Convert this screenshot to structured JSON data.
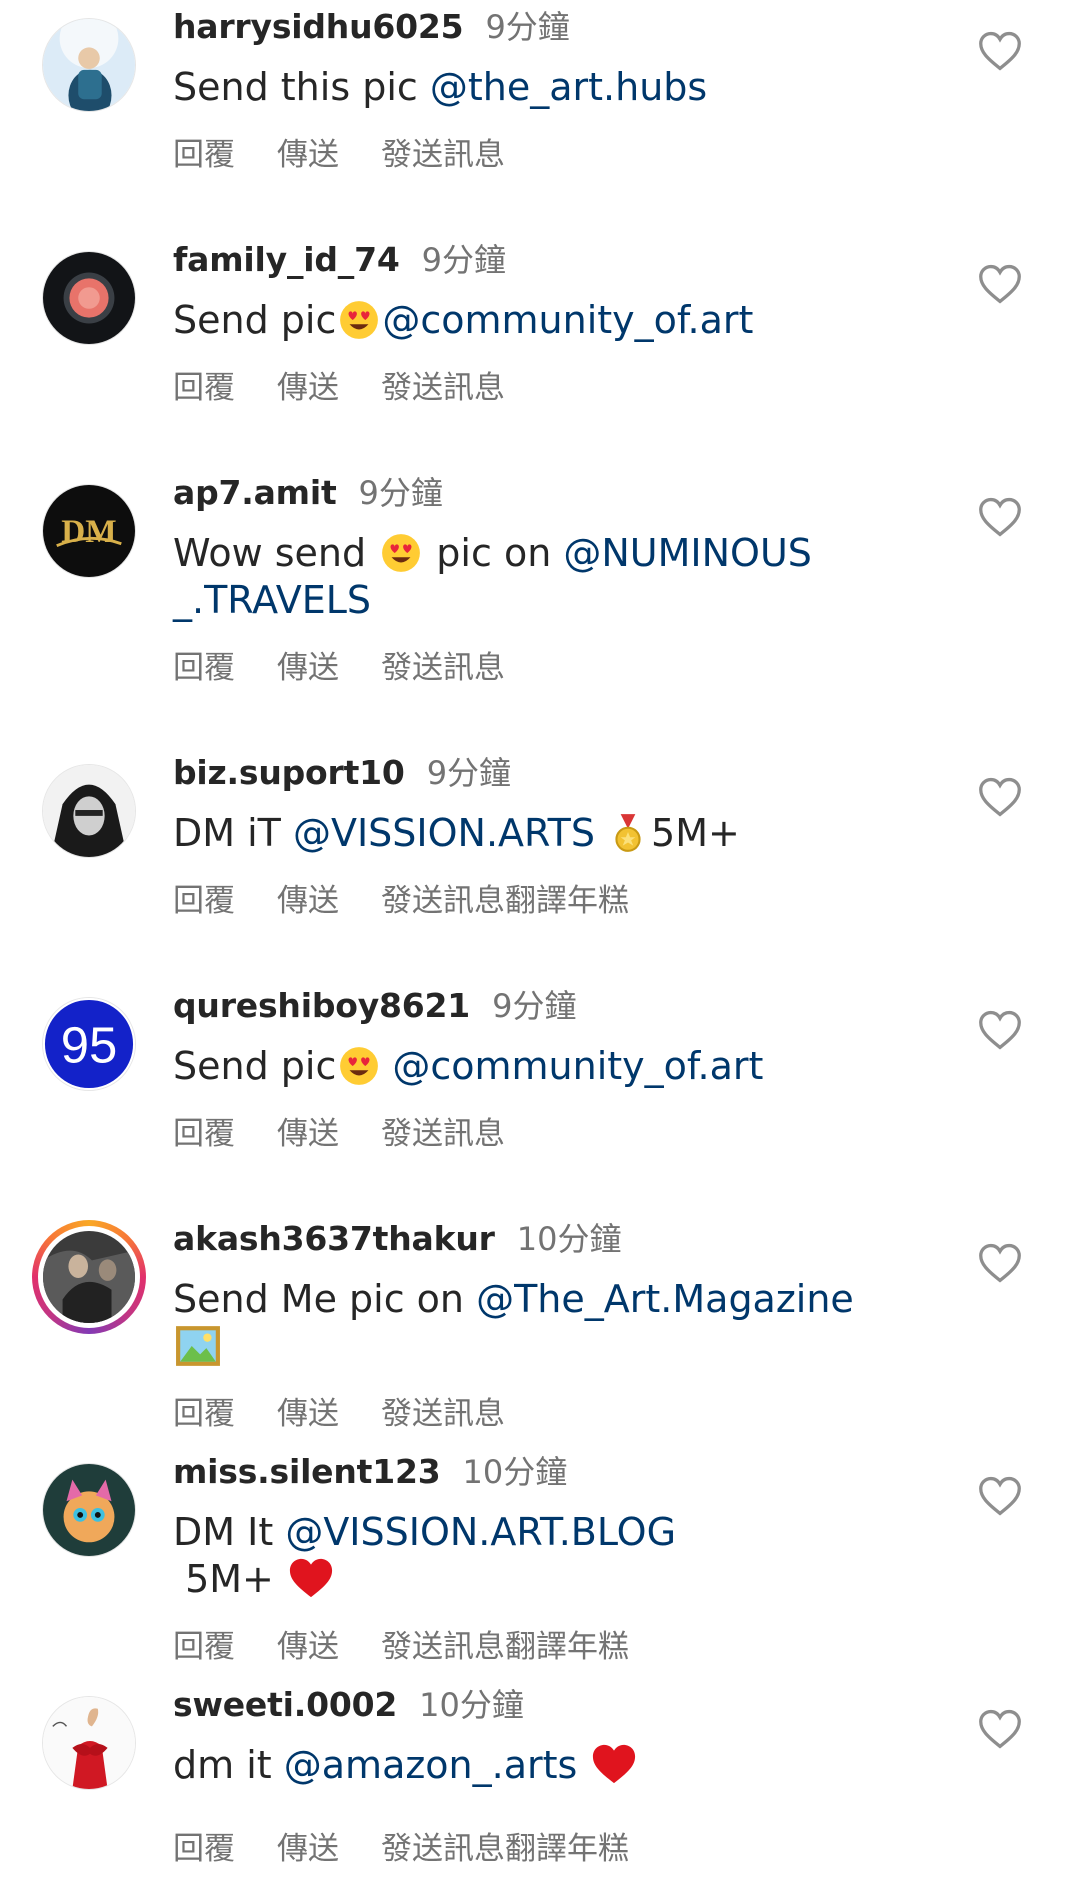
{
  "comments": [
    {
      "username": "harrysidhu6025",
      "time": "9分鐘",
      "text_before": "Send this pic ",
      "mention": "@the_art.hubs",
      "text_after": "",
      "actions": [
        "回覆",
        "傳送",
        "發送訊息"
      ]
    },
    {
      "username": "family_id_74",
      "time": "9分鐘",
      "text_before": "Send pic",
      "emoji": "heart-eyes-emoji",
      "mention": "@community_of.art",
      "text_after": "",
      "actions": [
        "回覆",
        "傳送",
        "發送訊息"
      ]
    },
    {
      "username": "ap7.amit",
      "time": "9分鐘",
      "text_before": "Wow send ",
      "emoji": "heart-eyes-emoji",
      "text_middle": " pic on ",
      "mention": "@NUMINOUS_.TRAVELS",
      "actions": [
        "回覆",
        "傳送",
        "發送訊息"
      ]
    },
    {
      "username": "biz.suport10",
      "time": "9分鐘",
      "text_before": "DM iT ",
      "mention": "@VISSION.ARTS",
      "emoji": "medal-emoji",
      "text_after": "5M+",
      "actions": [
        "回覆",
        "傳送",
        "發送訊息",
        "翻譯年糕"
      ]
    },
    {
      "username": "qureshiboy8621",
      "time": "9分鐘",
      "text_before": "Send pic",
      "emoji": "heart-eyes-emoji",
      "mention": "@community_of.art",
      "actions": [
        "回覆",
        "傳送",
        "發送訊息"
      ]
    },
    {
      "username": "akash3637thakur",
      "time": "10分鐘",
      "text_before": "Send Me pic on ",
      "mention": "@The_Art.Magazine",
      "emoji": "framed-picture-emoji",
      "actions": [
        "回覆",
        "傳送",
        "發送訊息"
      ]
    },
    {
      "username": "miss.silent123",
      "time": "10分鐘",
      "text_before": "DM It ",
      "mention": "@VISSION.ART.BLOG",
      "text_after": " 5M+ ",
      "emoji": "red-heart-emoji",
      "actions": [
        "回覆",
        "傳送",
        "發送訊息",
        "翻譯年糕"
      ]
    },
    {
      "username": "sweeti.0002",
      "time": "10分鐘",
      "text_before": "dm it ",
      "mention": "@amazon_.arts",
      "text_after": " ",
      "emoji": "red-heart-emoji",
      "actions": [
        "回覆",
        "傳送",
        "發送訊息",
        "翻譯年糕"
      ]
    }
  ],
  "avatars": {
    "c4_label": "DM",
    "c5_label": "95"
  },
  "colors": {
    "username": "#262626",
    "meta": "#737373",
    "mention": "#00376b",
    "heart_outline": "#8e8e8e"
  }
}
